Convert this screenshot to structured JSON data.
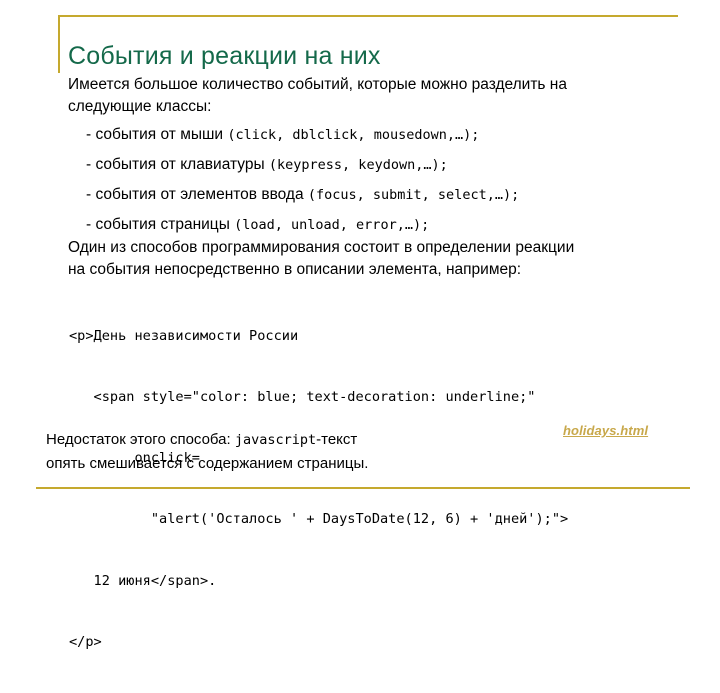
{
  "slide": {
    "title": "События и реакции на них",
    "accent_color": "#c5a92e",
    "title_color": "#14694a",
    "link_color": "#c8a84b",
    "background": "#ffffff"
  },
  "intro": {
    "lines": [
      "Имеется большое количество событий, которые можно разделить на",
      "следующие классы:"
    ]
  },
  "bullets": [
    {
      "dash": "-",
      "text": "события от мыши ",
      "code": "(click, dblclick, mousedown,…);"
    },
    {
      "dash": "-",
      "text": "события от клавиатуры ",
      "code": "(keypress, keydown,…);"
    },
    {
      "dash": "-",
      "text": "события от элементов ввода ",
      "code": "(focus, submit, select,…);"
    },
    {
      "dash": "-",
      "text": "события страницы ",
      "code": "(load, unload, error,…);"
    }
  ],
  "paragraph2": {
    "lines": [
      "Один из способов программирования состоит в определении реакции",
      "на события непосредственно в описании элемента, например:"
    ]
  },
  "code": {
    "lines": [
      "<p>День независимости России",
      "   <span style=\"color: blue; text-decoration: underline;\"",
      "        onclick=",
      "          \"alert('Осталось ' + DaysToDate(12, 6) + 'дней');\">",
      "   12 июня</span>.",
      "</p>"
    ]
  },
  "note": {
    "line1_prefix": "Недостаток этого способа: ",
    "line1_code": "javascript",
    "line1_suffix": "-текст",
    "line2": "опять смешивается с содержанием страницы."
  },
  "file_link": {
    "label": "holidays.html"
  }
}
